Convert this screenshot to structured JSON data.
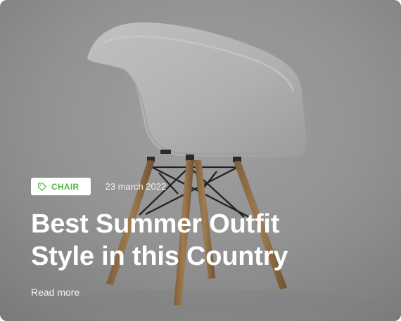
{
  "post": {
    "category": "CHAIR",
    "category_icon": "tag-icon",
    "date": "23 march 2022",
    "title_line_1": "Best Summer Outfit",
    "title_line_2": "Style in this Country",
    "read_more": "Read more"
  },
  "image": {
    "subject": "chair-photo"
  },
  "colors": {
    "accent": "#56b849",
    "card_background": "#8d8d8d",
    "text": "#ffffff"
  }
}
